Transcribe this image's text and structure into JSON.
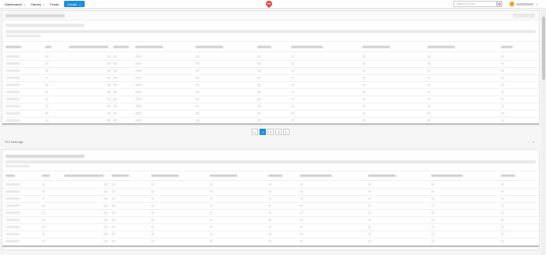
{
  "nav": {
    "dashboards": "Dashboards",
    "games": "Games",
    "feeds": "Feeds",
    "create": "Create"
  },
  "search": {
    "placeholder": "Search a-zone..."
  },
  "pager": {
    "prev": "«",
    "pages": [
      "1",
      "2",
      "3"
    ],
    "next": "»"
  },
  "status": {
    "timestamp": "3:12 hours ago"
  },
  "colors": {
    "accent": "#1a8fdb",
    "logo": "#e8453c"
  }
}
